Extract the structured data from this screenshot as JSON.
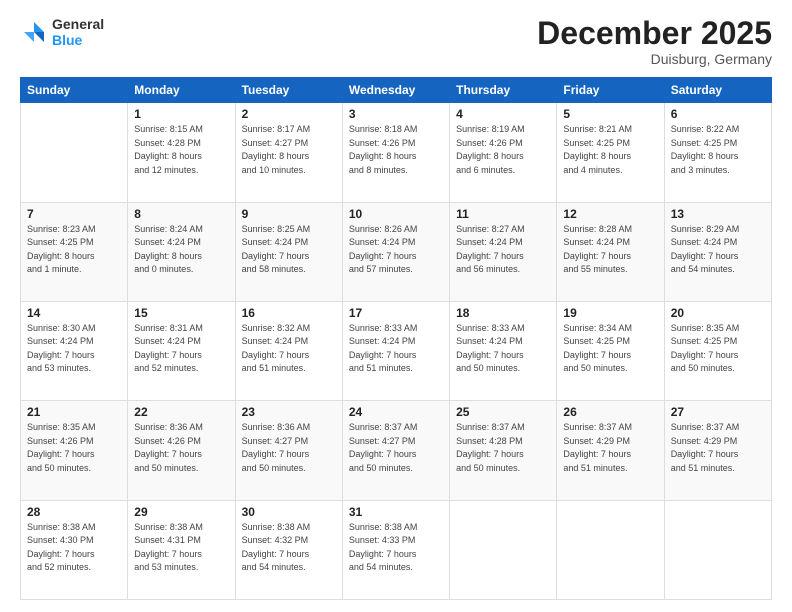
{
  "header": {
    "logo_general": "General",
    "logo_blue": "Blue",
    "month_title": "December 2025",
    "location": "Duisburg, Germany"
  },
  "weekdays": [
    "Sunday",
    "Monday",
    "Tuesday",
    "Wednesday",
    "Thursday",
    "Friday",
    "Saturday"
  ],
  "weeks": [
    [
      {
        "day": "",
        "info": ""
      },
      {
        "day": "1",
        "info": "Sunrise: 8:15 AM\nSunset: 4:28 PM\nDaylight: 8 hours\nand 12 minutes."
      },
      {
        "day": "2",
        "info": "Sunrise: 8:17 AM\nSunset: 4:27 PM\nDaylight: 8 hours\nand 10 minutes."
      },
      {
        "day": "3",
        "info": "Sunrise: 8:18 AM\nSunset: 4:26 PM\nDaylight: 8 hours\nand 8 minutes."
      },
      {
        "day": "4",
        "info": "Sunrise: 8:19 AM\nSunset: 4:26 PM\nDaylight: 8 hours\nand 6 minutes."
      },
      {
        "day": "5",
        "info": "Sunrise: 8:21 AM\nSunset: 4:25 PM\nDaylight: 8 hours\nand 4 minutes."
      },
      {
        "day": "6",
        "info": "Sunrise: 8:22 AM\nSunset: 4:25 PM\nDaylight: 8 hours\nand 3 minutes."
      }
    ],
    [
      {
        "day": "7",
        "info": "Sunrise: 8:23 AM\nSunset: 4:25 PM\nDaylight: 8 hours\nand 1 minute."
      },
      {
        "day": "8",
        "info": "Sunrise: 8:24 AM\nSunset: 4:24 PM\nDaylight: 8 hours\nand 0 minutes."
      },
      {
        "day": "9",
        "info": "Sunrise: 8:25 AM\nSunset: 4:24 PM\nDaylight: 7 hours\nand 58 minutes."
      },
      {
        "day": "10",
        "info": "Sunrise: 8:26 AM\nSunset: 4:24 PM\nDaylight: 7 hours\nand 57 minutes."
      },
      {
        "day": "11",
        "info": "Sunrise: 8:27 AM\nSunset: 4:24 PM\nDaylight: 7 hours\nand 56 minutes."
      },
      {
        "day": "12",
        "info": "Sunrise: 8:28 AM\nSunset: 4:24 PM\nDaylight: 7 hours\nand 55 minutes."
      },
      {
        "day": "13",
        "info": "Sunrise: 8:29 AM\nSunset: 4:24 PM\nDaylight: 7 hours\nand 54 minutes."
      }
    ],
    [
      {
        "day": "14",
        "info": "Sunrise: 8:30 AM\nSunset: 4:24 PM\nDaylight: 7 hours\nand 53 minutes."
      },
      {
        "day": "15",
        "info": "Sunrise: 8:31 AM\nSunset: 4:24 PM\nDaylight: 7 hours\nand 52 minutes."
      },
      {
        "day": "16",
        "info": "Sunrise: 8:32 AM\nSunset: 4:24 PM\nDaylight: 7 hours\nand 51 minutes."
      },
      {
        "day": "17",
        "info": "Sunrise: 8:33 AM\nSunset: 4:24 PM\nDaylight: 7 hours\nand 51 minutes."
      },
      {
        "day": "18",
        "info": "Sunrise: 8:33 AM\nSunset: 4:24 PM\nDaylight: 7 hours\nand 50 minutes."
      },
      {
        "day": "19",
        "info": "Sunrise: 8:34 AM\nSunset: 4:25 PM\nDaylight: 7 hours\nand 50 minutes."
      },
      {
        "day": "20",
        "info": "Sunrise: 8:35 AM\nSunset: 4:25 PM\nDaylight: 7 hours\nand 50 minutes."
      }
    ],
    [
      {
        "day": "21",
        "info": "Sunrise: 8:35 AM\nSunset: 4:26 PM\nDaylight: 7 hours\nand 50 minutes."
      },
      {
        "day": "22",
        "info": "Sunrise: 8:36 AM\nSunset: 4:26 PM\nDaylight: 7 hours\nand 50 minutes."
      },
      {
        "day": "23",
        "info": "Sunrise: 8:36 AM\nSunset: 4:27 PM\nDaylight: 7 hours\nand 50 minutes."
      },
      {
        "day": "24",
        "info": "Sunrise: 8:37 AM\nSunset: 4:27 PM\nDaylight: 7 hours\nand 50 minutes."
      },
      {
        "day": "25",
        "info": "Sunrise: 8:37 AM\nSunset: 4:28 PM\nDaylight: 7 hours\nand 50 minutes."
      },
      {
        "day": "26",
        "info": "Sunrise: 8:37 AM\nSunset: 4:29 PM\nDaylight: 7 hours\nand 51 minutes."
      },
      {
        "day": "27",
        "info": "Sunrise: 8:37 AM\nSunset: 4:29 PM\nDaylight: 7 hours\nand 51 minutes."
      }
    ],
    [
      {
        "day": "28",
        "info": "Sunrise: 8:38 AM\nSunset: 4:30 PM\nDaylight: 7 hours\nand 52 minutes."
      },
      {
        "day": "29",
        "info": "Sunrise: 8:38 AM\nSunset: 4:31 PM\nDaylight: 7 hours\nand 53 minutes."
      },
      {
        "day": "30",
        "info": "Sunrise: 8:38 AM\nSunset: 4:32 PM\nDaylight: 7 hours\nand 54 minutes."
      },
      {
        "day": "31",
        "info": "Sunrise: 8:38 AM\nSunset: 4:33 PM\nDaylight: 7 hours\nand 54 minutes."
      },
      {
        "day": "",
        "info": ""
      },
      {
        "day": "",
        "info": ""
      },
      {
        "day": "",
        "info": ""
      }
    ]
  ]
}
